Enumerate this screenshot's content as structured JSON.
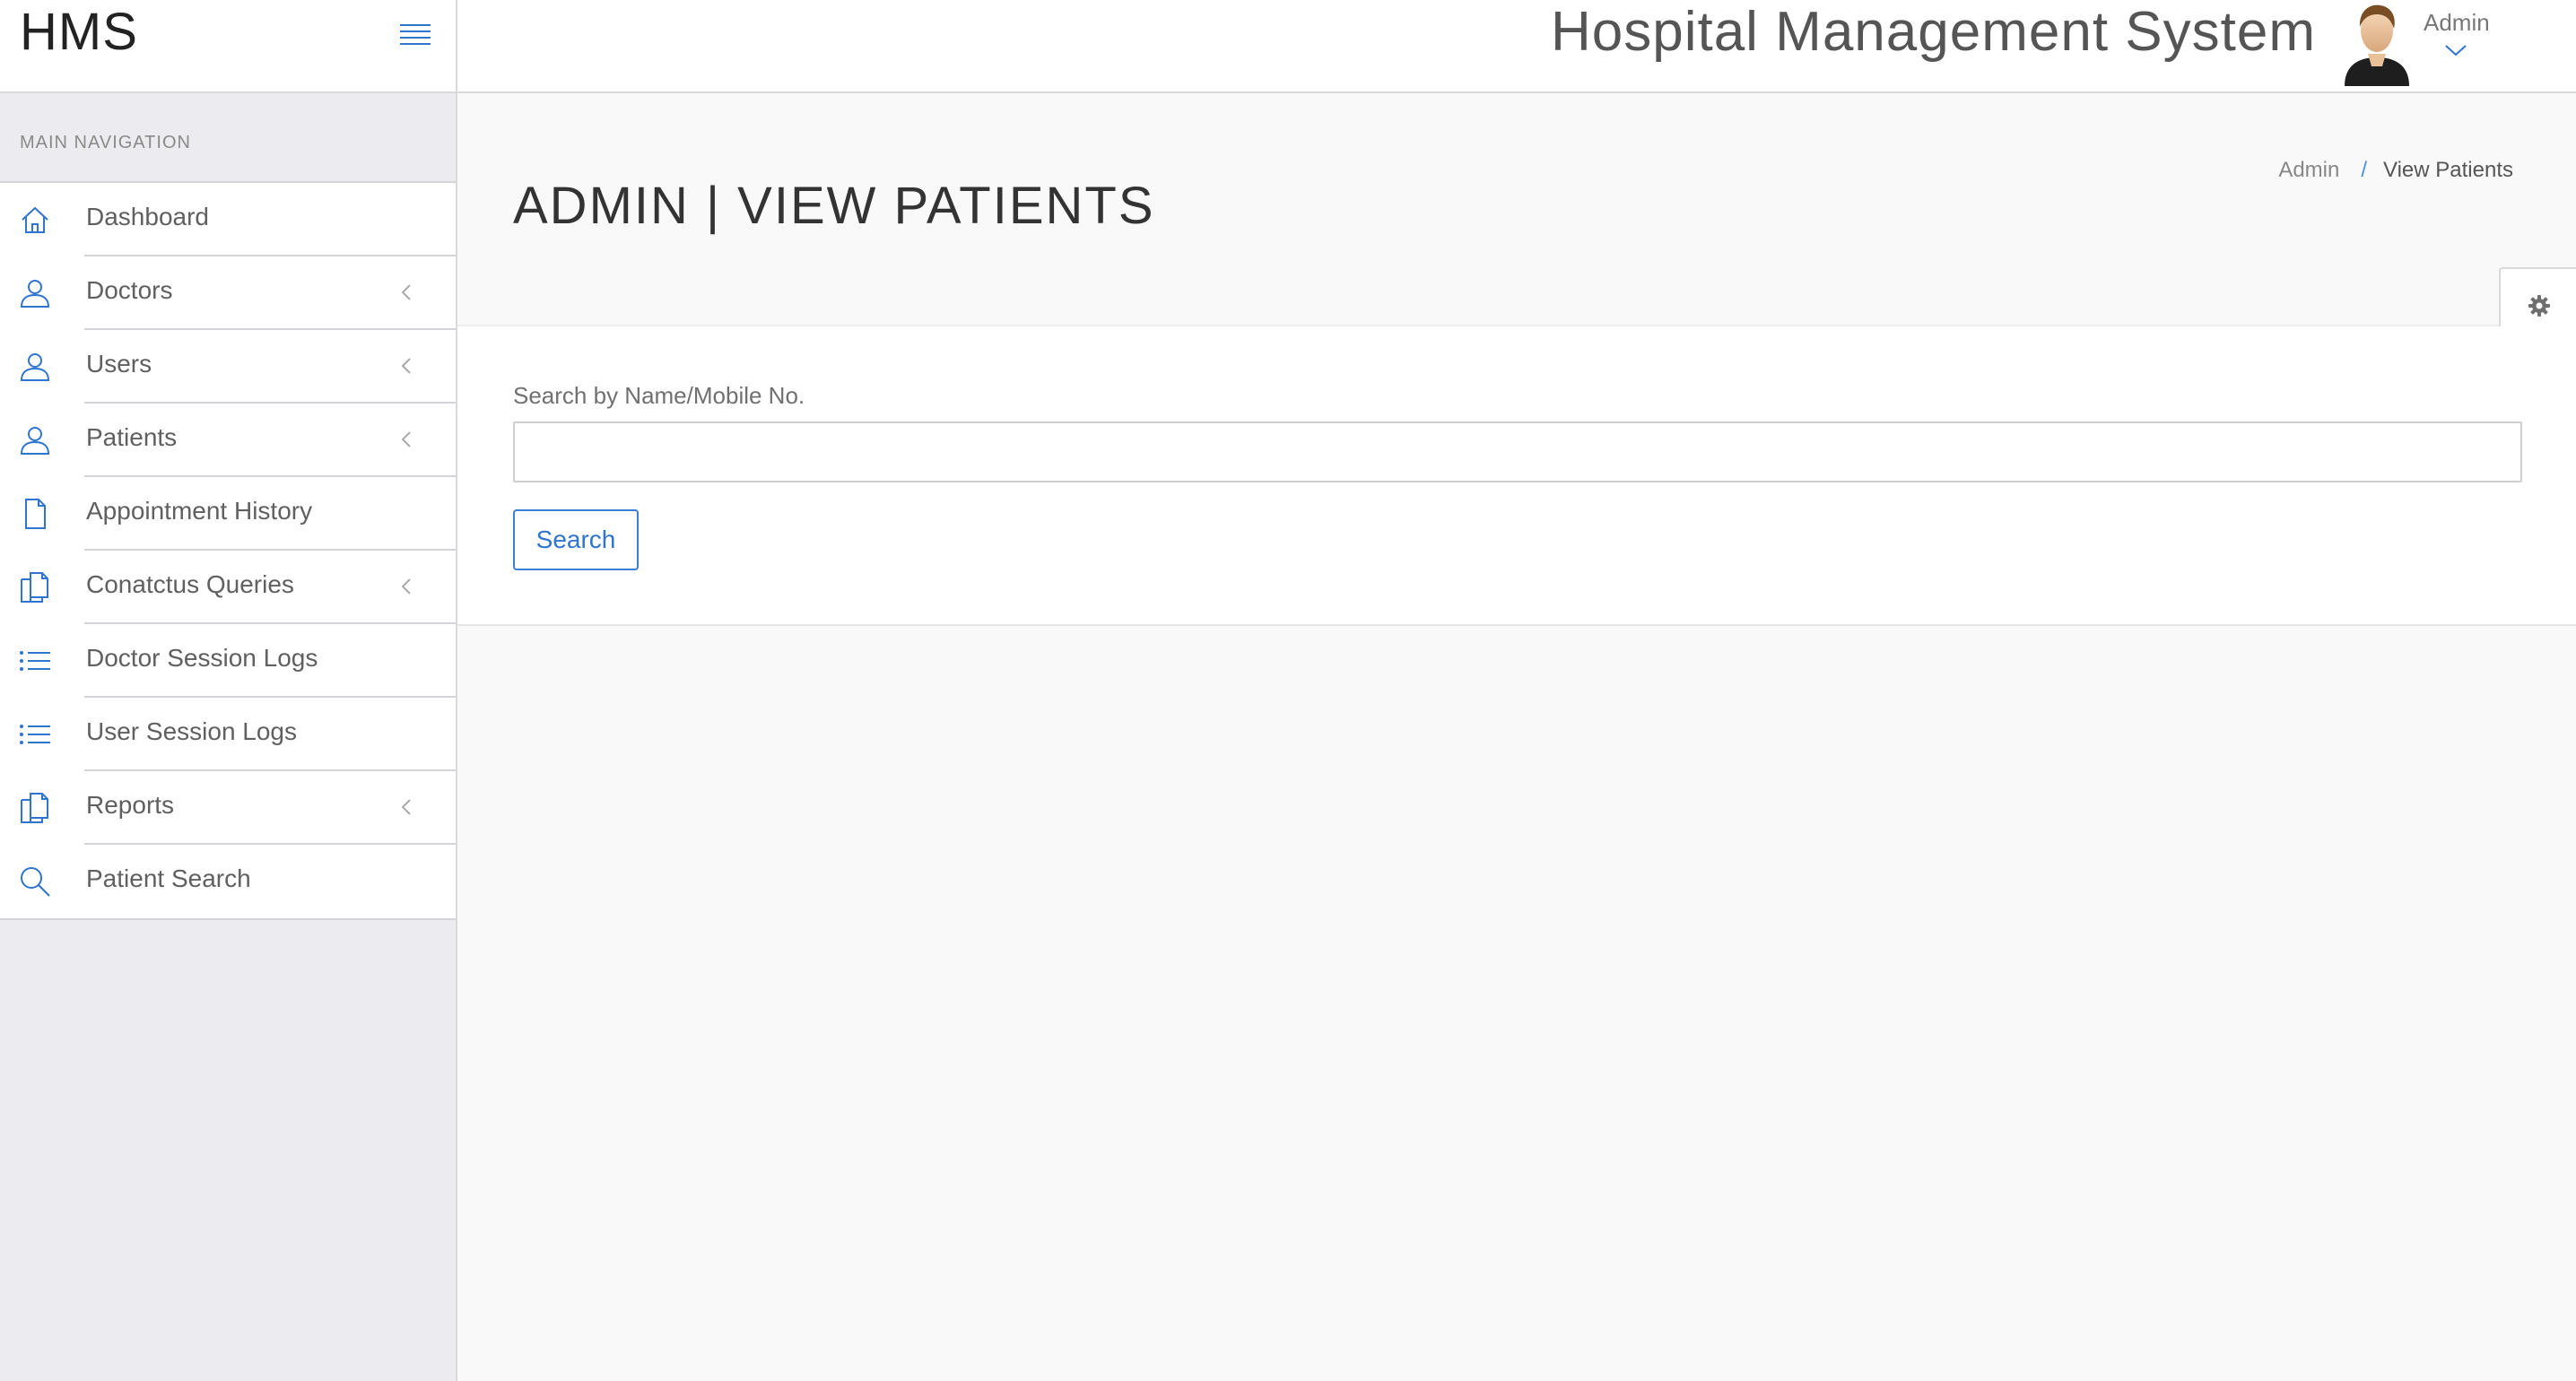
{
  "header": {
    "brand": "HMS",
    "app_title": "Hospital Management System",
    "user_name": "Admin"
  },
  "sidebar": {
    "heading": "MAIN NAVIGATION",
    "items": [
      {
        "label": "Dashboard",
        "icon": "home-icon",
        "has_submenu": false
      },
      {
        "label": "Doctors",
        "icon": "user-icon",
        "has_submenu": true
      },
      {
        "label": "Users",
        "icon": "user-icon",
        "has_submenu": true
      },
      {
        "label": "Patients",
        "icon": "user-icon",
        "has_submenu": true
      },
      {
        "label": "Appointment History",
        "icon": "file-icon",
        "has_submenu": false
      },
      {
        "label": "Conatctus Queries",
        "icon": "files-icon",
        "has_submenu": true
      },
      {
        "label": "Doctor Session Logs",
        "icon": "list-icon",
        "has_submenu": false
      },
      {
        "label": "User Session Logs",
        "icon": "list-icon",
        "has_submenu": false
      },
      {
        "label": "Reports",
        "icon": "files-icon",
        "has_submenu": true
      },
      {
        "label": "Patient Search",
        "icon": "search-icon",
        "has_submenu": false
      }
    ]
  },
  "page": {
    "title": "ADMIN | VIEW PATIENTS",
    "breadcrumb": {
      "root": "Admin",
      "current": "View Patients"
    }
  },
  "search": {
    "label": "Search by Name/Mobile No.",
    "value": "",
    "placeholder": "",
    "button_label": "Search"
  },
  "colors": {
    "accent": "#2f74cf",
    "sidebar_bg": "#ececf0",
    "page_bg": "#f9f9f9"
  }
}
